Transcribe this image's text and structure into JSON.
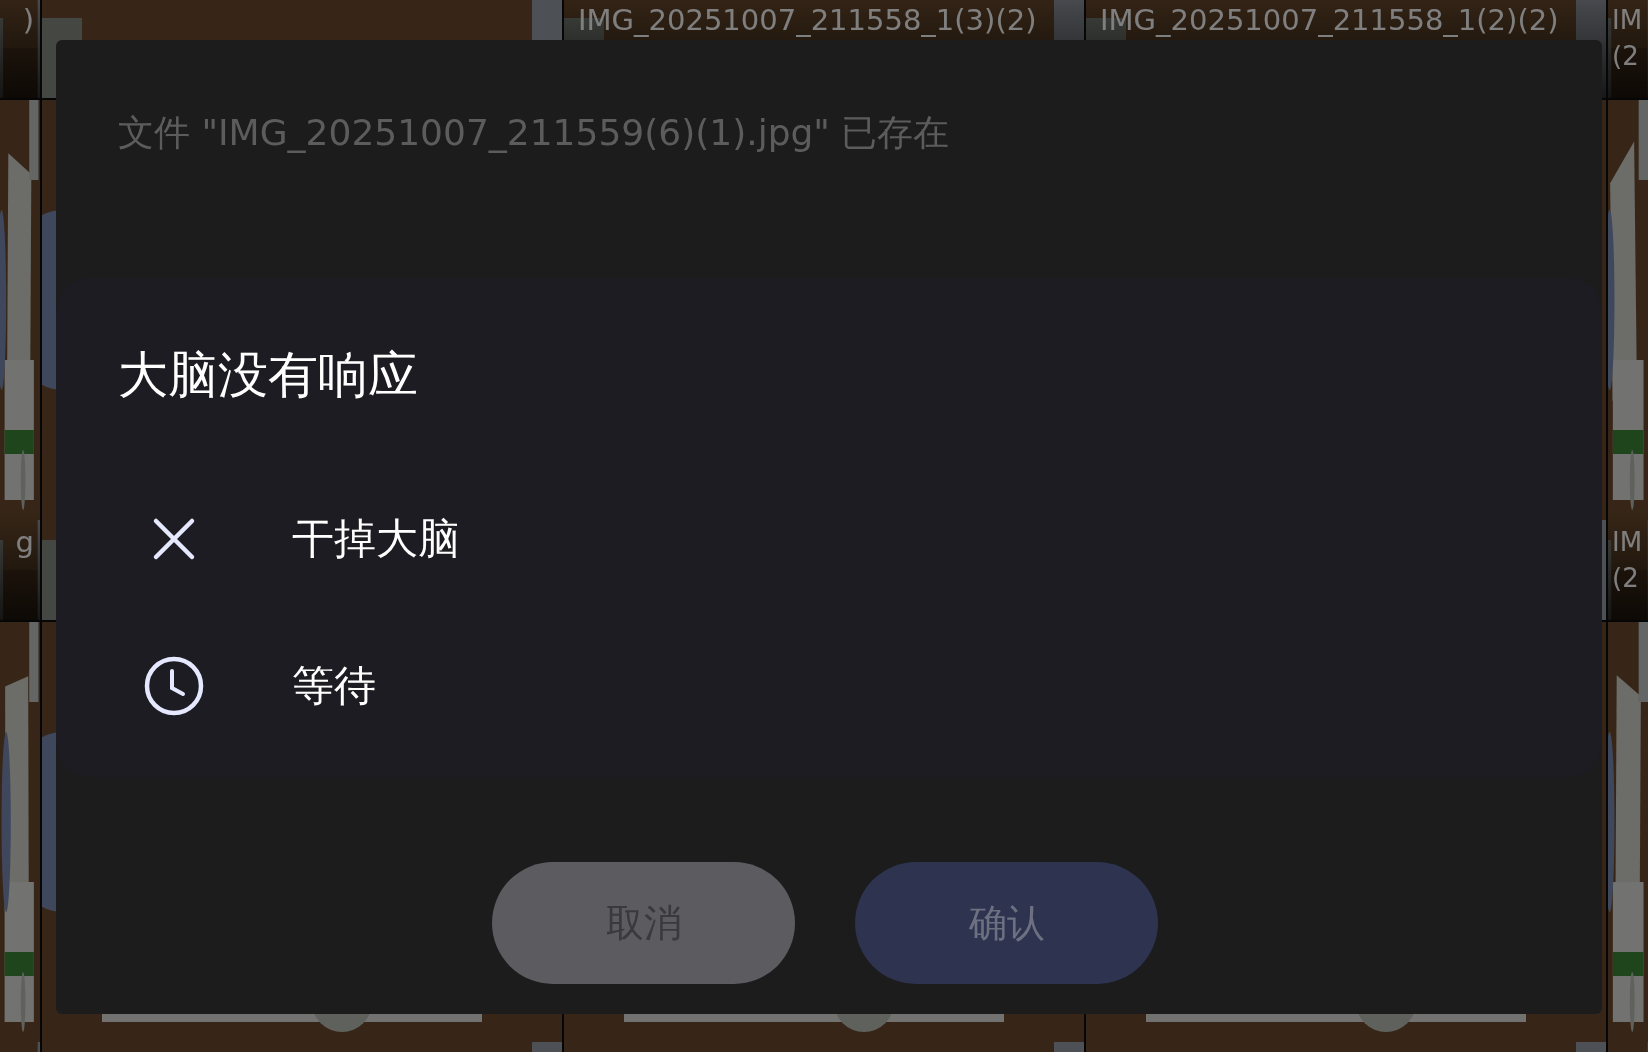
{
  "thumbnail_rows": [
    {
      "tiles": [
        {
          "kind": "picture",
          "caption": [
            ")"
          ]
        },
        {
          "kind": "picture"
        },
        {
          "kind": "picture",
          "caption": [
            "IMG_20251007_211558_1(3)(2)"
          ]
        },
        {
          "kind": "picture",
          "caption": [
            "IMG_20251007_211558_1(2)(2)"
          ]
        },
        {
          "kind": "picture",
          "caption": [
            "IM",
            "(2"
          ]
        }
      ]
    },
    {
      "tiles": [
        {
          "kind": "picture",
          "caption": [
            "g"
          ]
        },
        {
          "kind": "picture"
        },
        {
          "kind": "covered"
        },
        {
          "kind": "picture"
        },
        {
          "kind": "picture",
          "caption": [
            "IM",
            "(2"
          ]
        }
      ]
    },
    {
      "tiles": [
        {
          "kind": "picture"
        },
        {
          "kind": "picture"
        },
        {
          "kind": "picture"
        },
        {
          "kind": "picture"
        },
        {
          "kind": "picture"
        }
      ]
    }
  ],
  "file_exists_dialog": {
    "message": "文件 \"IMG_20251007_211559(6)(1).jpg\" 已存在",
    "buttons": [
      {
        "label": "取消",
        "kind": "secondary"
      },
      {
        "label": "确认",
        "kind": "primary"
      }
    ]
  },
  "not_responding_dialog": {
    "title": "大脑没有响应",
    "options": [
      {
        "label": "干掉大脑",
        "kind": "close"
      },
      {
        "label": "等待",
        "kind": "wait"
      }
    ]
  }
}
